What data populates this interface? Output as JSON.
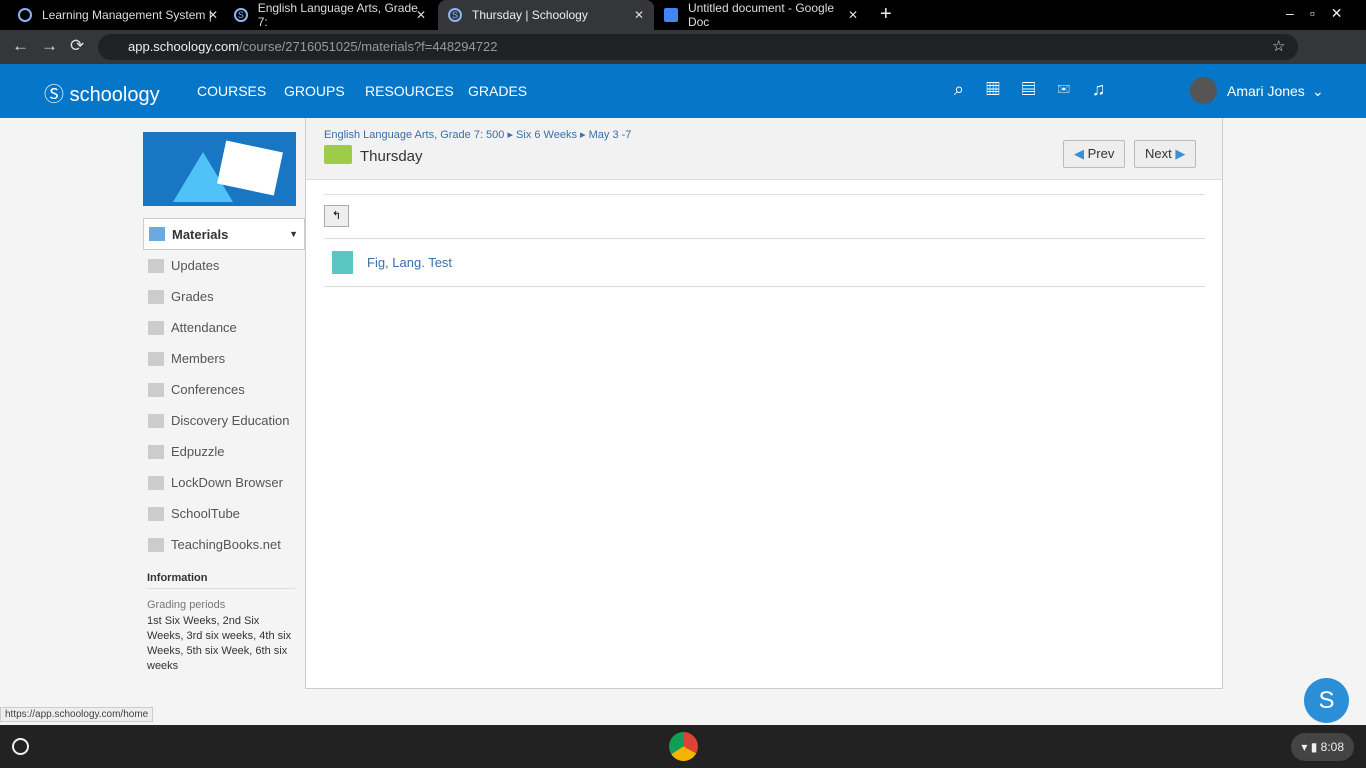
{
  "browser": {
    "tabs": [
      "Learning Management System |",
      "English Language Arts, Grade 7:",
      "Thursday | Schoology",
      "Untitled document - Google Doc"
    ],
    "url_host": "app.schoology.com",
    "url_path": "/course/2716051025/materials?f=448294722"
  },
  "nav": {
    "logo": "schoology",
    "menu": [
      "COURSES",
      "GROUPS",
      "RESOURCES",
      "GRADES"
    ],
    "user": "Amari Jones"
  },
  "sidebar": {
    "active": "Materials",
    "items": [
      "Updates",
      "Grades",
      "Attendance",
      "Members",
      "Conferences",
      "Discovery Education",
      "Edpuzzle",
      "LockDown Browser",
      "SchoolTube",
      "TeachingBooks.net"
    ],
    "info_title": "Information",
    "grading_label": "Grading periods",
    "grading_value": "1st Six Weeks, 2nd Six Weeks, 3rd six weeks, 4th six Weeks, 5th six Week, 6th six weeks"
  },
  "main": {
    "breadcrumb": [
      "English Language Arts, Grade 7: 500",
      "Six 6 Weeks",
      "May 3 -7"
    ],
    "title": "Thursday",
    "prev": "Prev",
    "next": "Next",
    "items": [
      "Fig, Lang. Test"
    ]
  },
  "status_url": "https://app.schoology.com/home",
  "chat_badge": "S",
  "clock": "8:08"
}
